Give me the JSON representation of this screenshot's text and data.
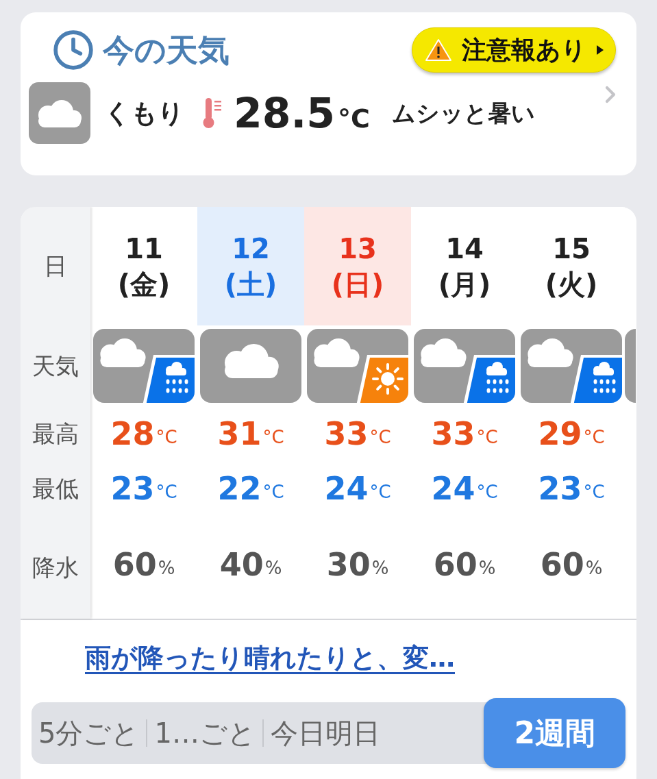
{
  "current": {
    "title": "今の天気",
    "alert": "注意報あり",
    "icon": {
      "kind": "cloudy"
    },
    "condition": "くもり",
    "temperature": "28.5",
    "unit": "°C",
    "feeling": "ムシッと暑い"
  },
  "forecast": {
    "row_labels": [
      "日",
      "天気",
      "最高",
      "最低",
      "降水"
    ],
    "days": [
      {
        "date": "11",
        "weekday": "(金)",
        "kind": "weekday",
        "weather": {
          "kind": "cloudy-rain"
        },
        "high": "28",
        "high_unit": "°C",
        "low": "23",
        "low_unit": "°C",
        "rain": "60",
        "rain_unit": "%"
      },
      {
        "date": "12",
        "weekday": "(土)",
        "kind": "saturday",
        "weather": {
          "kind": "cloudy"
        },
        "high": "31",
        "high_unit": "°C",
        "low": "22",
        "low_unit": "°C",
        "rain": "40",
        "rain_unit": "%"
      },
      {
        "date": "13",
        "weekday": "(日)",
        "kind": "sunday",
        "weather": {
          "kind": "cloudy-sun"
        },
        "high": "33",
        "high_unit": "°C",
        "low": "24",
        "low_unit": "°C",
        "rain": "30",
        "rain_unit": "%"
      },
      {
        "date": "14",
        "weekday": "(月)",
        "kind": "weekday",
        "weather": {
          "kind": "cloudy-rain"
        },
        "high": "33",
        "high_unit": "°C",
        "low": "24",
        "low_unit": "°C",
        "rain": "60",
        "rain_unit": "%"
      },
      {
        "date": "15",
        "weekday": "(火)",
        "kind": "weekday",
        "weather": {
          "kind": "cloudy-rain"
        },
        "high": "29",
        "high_unit": "°C",
        "low": "23",
        "low_unit": "°C",
        "rain": "60",
        "rain_unit": "%"
      }
    ]
  },
  "comment": "雨が降ったり晴れたりと、変…",
  "tabs": [
    {
      "label": "5分ごと",
      "selected": false
    },
    {
      "label": "1…ごと",
      "selected": false
    },
    {
      "label": "今日明日",
      "selected": false
    },
    {
      "label": "2週間",
      "selected": true
    }
  ]
}
